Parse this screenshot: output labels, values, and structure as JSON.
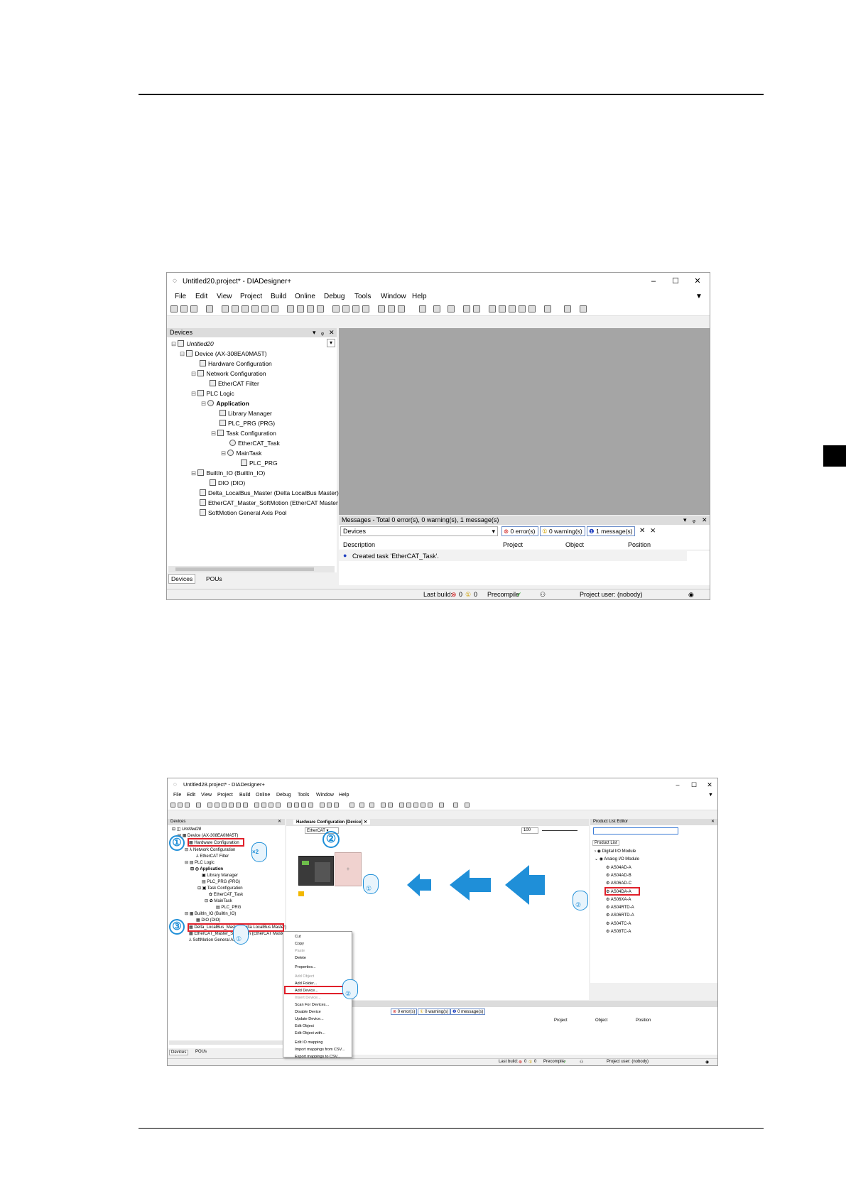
{
  "shot1": {
    "title": "Untitled20.project* - DIADesigner+",
    "menu": [
      "File",
      "Edit",
      "View",
      "Project",
      "Build",
      "Online",
      "Debug",
      "Tools",
      "Window",
      "Help"
    ],
    "devices_panel_title": "Devices",
    "tree": [
      "Untitled20",
      "Device (AX-308EA0MA5T)",
      "Hardware Configuration",
      "Network Configuration",
      "EtherCAT Filter",
      "PLC Logic",
      "Application",
      "Library Manager",
      "PLC_PRG (PRG)",
      "Task Configuration",
      "EtherCAT_Task",
      "MainTask",
      "PLC_PRG",
      "BuiltIn_IO (BuiltIn_IO)",
      "DIO (DIO)",
      "Delta_LocalBus_Master (Delta LocalBus Master)",
      "EtherCAT_Master_SoftMotion (EtherCAT Master SoftM",
      "SoftMotion General Axis Pool"
    ],
    "bottom_tabs": [
      "Devices",
      "POUs"
    ],
    "messages": {
      "header": "Messages - Total 0 error(s), 0 warning(s), 1 message(s)",
      "filter_value": "Devices",
      "errors": "0 error(s)",
      "warnings": "0 warning(s)",
      "msgs": "1 message(s)",
      "columns": [
        "Description",
        "Project",
        "Object",
        "Position"
      ],
      "rows": [
        "Created task 'EtherCAT_Task'."
      ]
    },
    "status": {
      "last_build": "Last build:",
      "err_count": "0",
      "warn_count": "0",
      "precompile": "Precompile",
      "project_user": "Project user: (nobody)"
    }
  },
  "shot2": {
    "title": "Untitled28.project* - DIADesigner+",
    "menu": [
      "File",
      "Edit",
      "View",
      "Project",
      "Build",
      "Online",
      "Debug",
      "Tools",
      "Window",
      "Help"
    ],
    "devices_panel_title": "Devices",
    "tree": [
      "Untitled28",
      "Device (AX-308EA0MA5T)",
      "Hardware Configuration",
      "Network Configuration",
      "EtherCAT Filter",
      "PLC Logic",
      "Application",
      "Library Manager",
      "PLC_PRG (PRG)",
      "Task Configuration",
      "EtherCAT_Task",
      "MainTask",
      "PLC_PRG",
      "BuiltIn_IO (BuiltIn_IO)",
      "DIO (DIO)",
      "Delta_LocalBus_Master (Delta LocalBus Master)",
      "EtherCAT_Master_SoftMotion (EtherCAT Master",
      "SoftMotion General Axis"
    ],
    "editor_tab": "Hardware Configuration [Device]",
    "network_select": "EtherCAT",
    "zoom": "100",
    "product_panel_title": "Product List Editor",
    "product_list_tab": "Product List",
    "product_tree": [
      "Digital I/O Module",
      "Analog I/O Module",
      "AS04AD-A",
      "AS04AD-B",
      "AS06AD-C",
      "AS04DA-A",
      "AS06XA-A",
      "AS04RTD-A",
      "AS06RTD-A",
      "AS04TC-A",
      "AS08TC-A"
    ],
    "context_menu": [
      "Cut",
      "Copy",
      "Paste",
      "Delete",
      "Properties...",
      "Add Object",
      "Add Folder...",
      "Add Device...",
      "Insert Device...",
      "Scan For Devices...",
      "Disable Device",
      "Update Device...",
      "Edit Object",
      "Edit Object with...",
      "Edit IO mapping",
      "Import mappings from CSV...",
      "Export mappings to CSV..."
    ],
    "messages": {
      "errors": "0 error(s)",
      "warnings": "0 warning(s)",
      "msgs": "0 message(s)",
      "columns": [
        "Project",
        "Object",
        "Position"
      ]
    },
    "bottom_tabs": [
      "Devices",
      "POUs"
    ],
    "status": {
      "last_build": "Last build:",
      "err_count": "0",
      "warn_count": "0",
      "precompile": "Precompile",
      "project_user": "Project user: (nobody)"
    },
    "badges": {
      "one": "①",
      "two": "②",
      "three": "③",
      "x2": "×2",
      "step1": "①",
      "step2": "②"
    }
  }
}
